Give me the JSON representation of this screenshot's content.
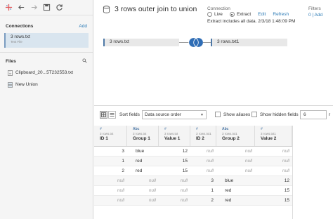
{
  "left_panel": {
    "connections_title": "Connections",
    "add_label": "Add",
    "connection": {
      "name": "3 rows.txt",
      "type": "Text File"
    },
    "files_title": "Files",
    "files": [
      {
        "name": "Clipboard_20...5T232553.txt"
      },
      {
        "name": "New Union"
      }
    ]
  },
  "header": {
    "title": "3 rows outer join to union",
    "connection_label": "Connection",
    "live_label": "Live",
    "extract_label": "Extract",
    "edit_label": "Edit",
    "refresh_label": "Refresh",
    "extract_note": "Extract includes all data. 2/3/18 1:48:09 PM",
    "filters_label": "Filters",
    "filters_count": "0 | Add"
  },
  "join": {
    "left_table": "3 rows.txt",
    "right_table": "3 rows.txt1"
  },
  "grid_toolbar": {
    "sort_label": "Sort fields",
    "sort_value": "Data source order",
    "show_aliases": "Show aliases",
    "show_hidden": "Show hidden fields",
    "rows_value": "6",
    "rows_suffix": "r"
  },
  "columns": [
    {
      "type": "#",
      "source": "3 rows.txt",
      "name": "ID 1"
    },
    {
      "type": "Abc",
      "source": "3 rows.txt",
      "name": "Group 1"
    },
    {
      "type": "#",
      "source": "3 rows.txt",
      "name": "Value 1"
    },
    {
      "type": "#",
      "source": "3 rows.txt1",
      "name": "ID 2"
    },
    {
      "type": "Abc",
      "source": "3 rows.txt1",
      "name": "Group 2"
    },
    {
      "type": "#",
      "source": "3 rows.txt1",
      "name": "Value 2"
    }
  ],
  "rows": [
    [
      "3",
      "blue",
      "12",
      "null",
      "null",
      "null"
    ],
    [
      "1",
      "red",
      "15",
      "null",
      "null",
      "null"
    ],
    [
      "2",
      "red",
      "15",
      "null",
      "null",
      "null"
    ],
    [
      "null",
      "null",
      "null",
      "3",
      "blue",
      "12"
    ],
    [
      "null",
      "null",
      "null",
      "1",
      "red",
      "15"
    ],
    [
      "null",
      "null",
      "null",
      "2",
      "red",
      "15"
    ]
  ],
  "colors": {
    "accent": "#2c7bb6",
    "table_bar": "#4e79a7",
    "join_fill": "#2f6db5"
  }
}
